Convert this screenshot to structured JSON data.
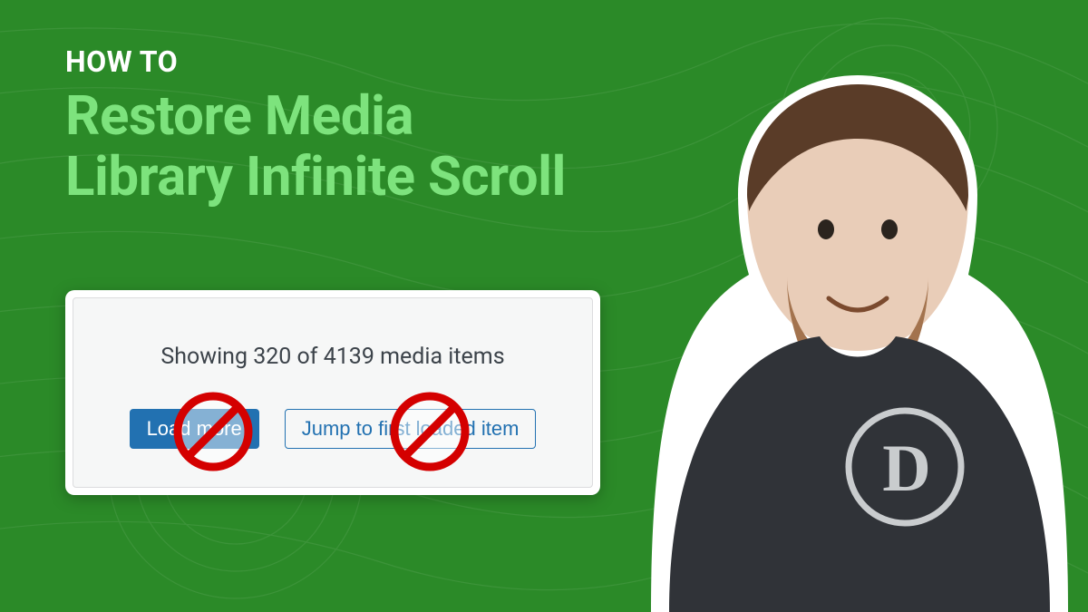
{
  "heading": {
    "eyebrow": "HOW TO",
    "title_line1": "Restore Media",
    "title_line2": "Library Infinite Scroll"
  },
  "card": {
    "status_text": "Showing 320 of 4139 media items",
    "load_more_label": "Load more",
    "jump_first_label": "Jump to first loaded item"
  }
}
